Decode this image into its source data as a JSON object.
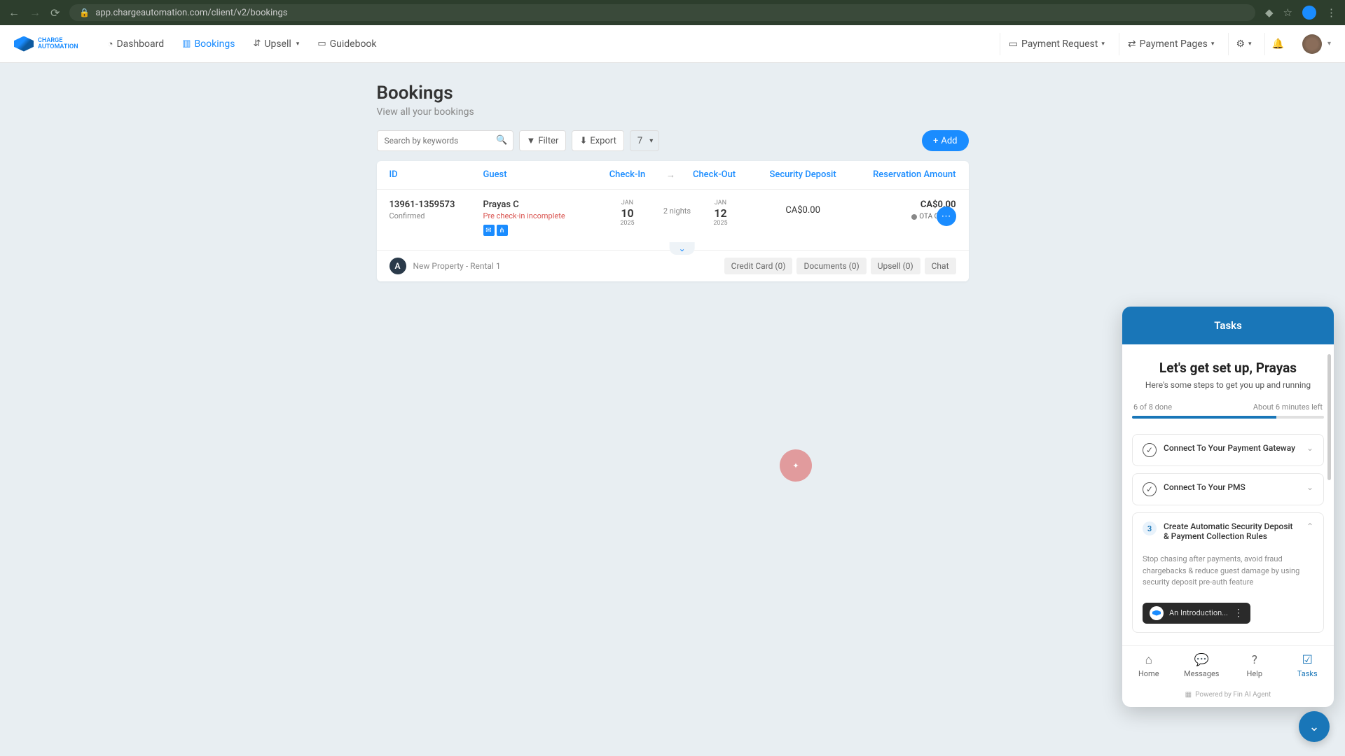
{
  "browser": {
    "url": "app.chargeautomation.com/client/v2/bookings"
  },
  "logo": {
    "line1": "CHARGE",
    "line2": "AUTOMATION"
  },
  "nav": {
    "dashboard": "Dashboard",
    "bookings": "Bookings",
    "upsell": "Upsell",
    "guidebook": "Guidebook",
    "payment_request": "Payment Request",
    "payment_pages": "Payment Pages"
  },
  "page": {
    "title": "Bookings",
    "subtitle": "View all your bookings"
  },
  "toolbar": {
    "search_placeholder": "Search by keywords",
    "filter": "Filter",
    "export": "Export",
    "page_size": "7",
    "add": "Add"
  },
  "columns": {
    "id": "ID",
    "guest": "Guest",
    "checkin": "Check-In",
    "arrow": "→",
    "checkout": "Check-Out",
    "deposit": "Security Deposit",
    "amount": "Reservation Amount"
  },
  "row": {
    "id": "13961-1359573",
    "status": "Confirmed",
    "guest_name": "Prayas C",
    "guest_status": "Pre check-in incomplete",
    "checkin": {
      "month": "JAN",
      "day": "10",
      "year": "2025"
    },
    "nights": "2 nights",
    "checkout": {
      "month": "JAN",
      "day": "12",
      "year": "2025"
    },
    "deposit": "CA$0.00",
    "amount": "CA$0.00",
    "ota": "OTA Collect"
  },
  "subrow": {
    "avatar_letter": "A",
    "property": "New Property - Rental 1",
    "credit_card": "Credit Card (0)",
    "documents": "Documents (0)",
    "upsell": "Upsell (0)",
    "chat": "Chat"
  },
  "tasks": {
    "header": "Tasks",
    "title": "Let's get set up, Prayas",
    "subtitle": "Here's some steps to get you up and running",
    "progress_left": "6 of 8 done",
    "progress_right": "About 6 minutes left",
    "item1": "Connect To Your Payment Gateway",
    "item2": "Connect To Your PMS",
    "item3_num": "3",
    "item3": "Create Automatic Security Deposit & Payment Collection Rules",
    "item3_desc": "Stop chasing after payments, avoid fraud chargebacks & reduce guest damage by using security deposit pre-auth feature",
    "video_title": "An Introduction...",
    "tabs": {
      "home": "Home",
      "messages": "Messages",
      "help": "Help",
      "tasks": "Tasks"
    },
    "powered": "Powered by Fin AI Agent"
  }
}
